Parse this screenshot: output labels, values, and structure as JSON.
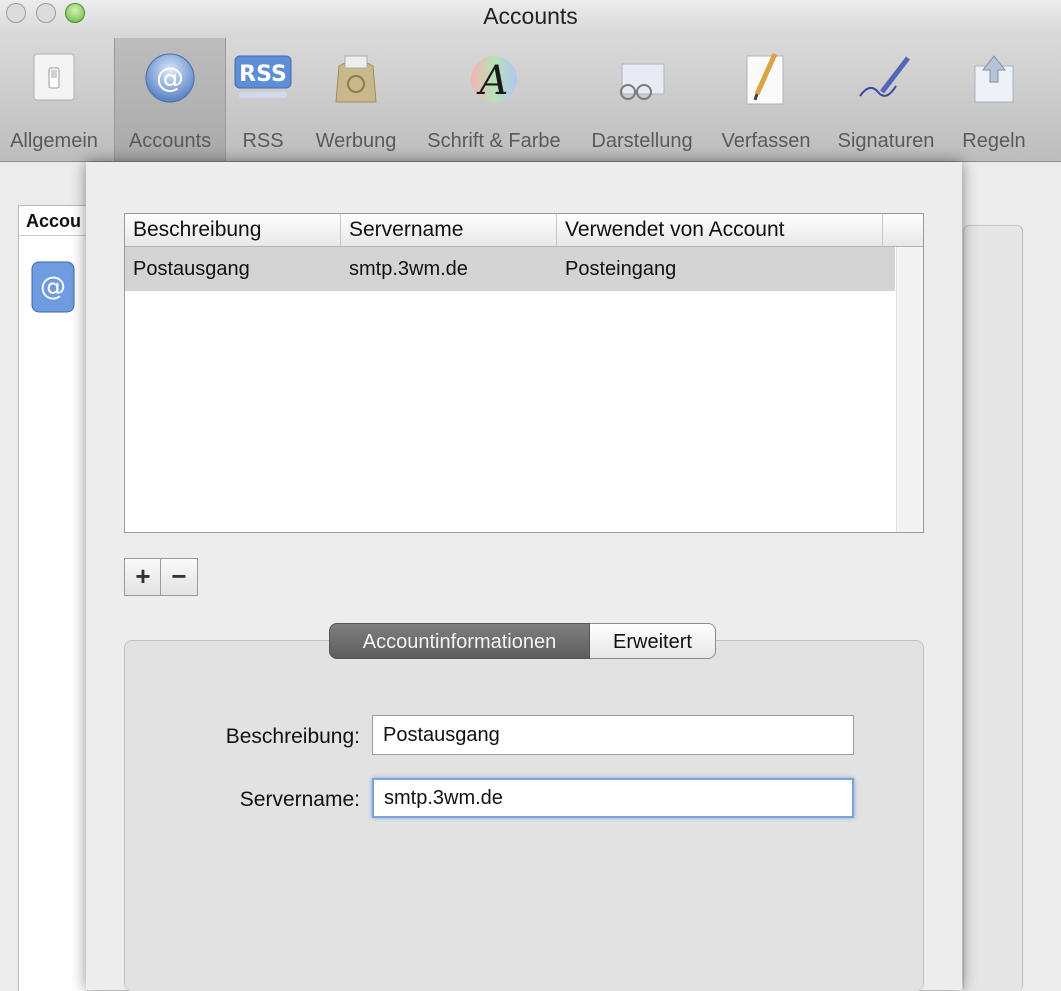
{
  "window": {
    "title": "Accounts"
  },
  "toolbar": {
    "items": [
      {
        "label": "Allgemein",
        "icon": "light-switch-icon"
      },
      {
        "label": "Accounts",
        "icon": "at-sign-icon",
        "selected": true
      },
      {
        "label": "RSS",
        "icon": "rss-icon"
      },
      {
        "label": "Werbung",
        "icon": "junk-mail-bag-icon"
      },
      {
        "label": "Schrift & Farbe",
        "icon": "font-color-icon"
      },
      {
        "label": "Darstellung",
        "icon": "glasses-icon"
      },
      {
        "label": "Verfassen",
        "icon": "pencil-paper-icon"
      },
      {
        "label": "Signaturen",
        "icon": "signature-pen-icon"
      },
      {
        "label": "Regeln",
        "icon": "rules-arrow-icon"
      }
    ]
  },
  "background": {
    "list_header": "Accou"
  },
  "smtp_table": {
    "columns": [
      "Beschreibung",
      "Servername",
      "Verwendet von Account"
    ],
    "rows": [
      {
        "beschreibung": "Postausgang",
        "servername": "smtp.3wm.de",
        "verwendet": "Posteingang"
      }
    ]
  },
  "buttons": {
    "add": "+",
    "remove": "−"
  },
  "tabs": {
    "account_info": "Accountinformationen",
    "advanced": "Erweitert"
  },
  "form": {
    "description_label": "Beschreibung:",
    "description_value": "Postausgang",
    "server_label": "Servername:",
    "server_value": "smtp.3wm.de"
  },
  "colors": {
    "selection": "#d4d4d4",
    "focus_ring": "#7da2d6",
    "tab_active": "#6a6a6a"
  }
}
